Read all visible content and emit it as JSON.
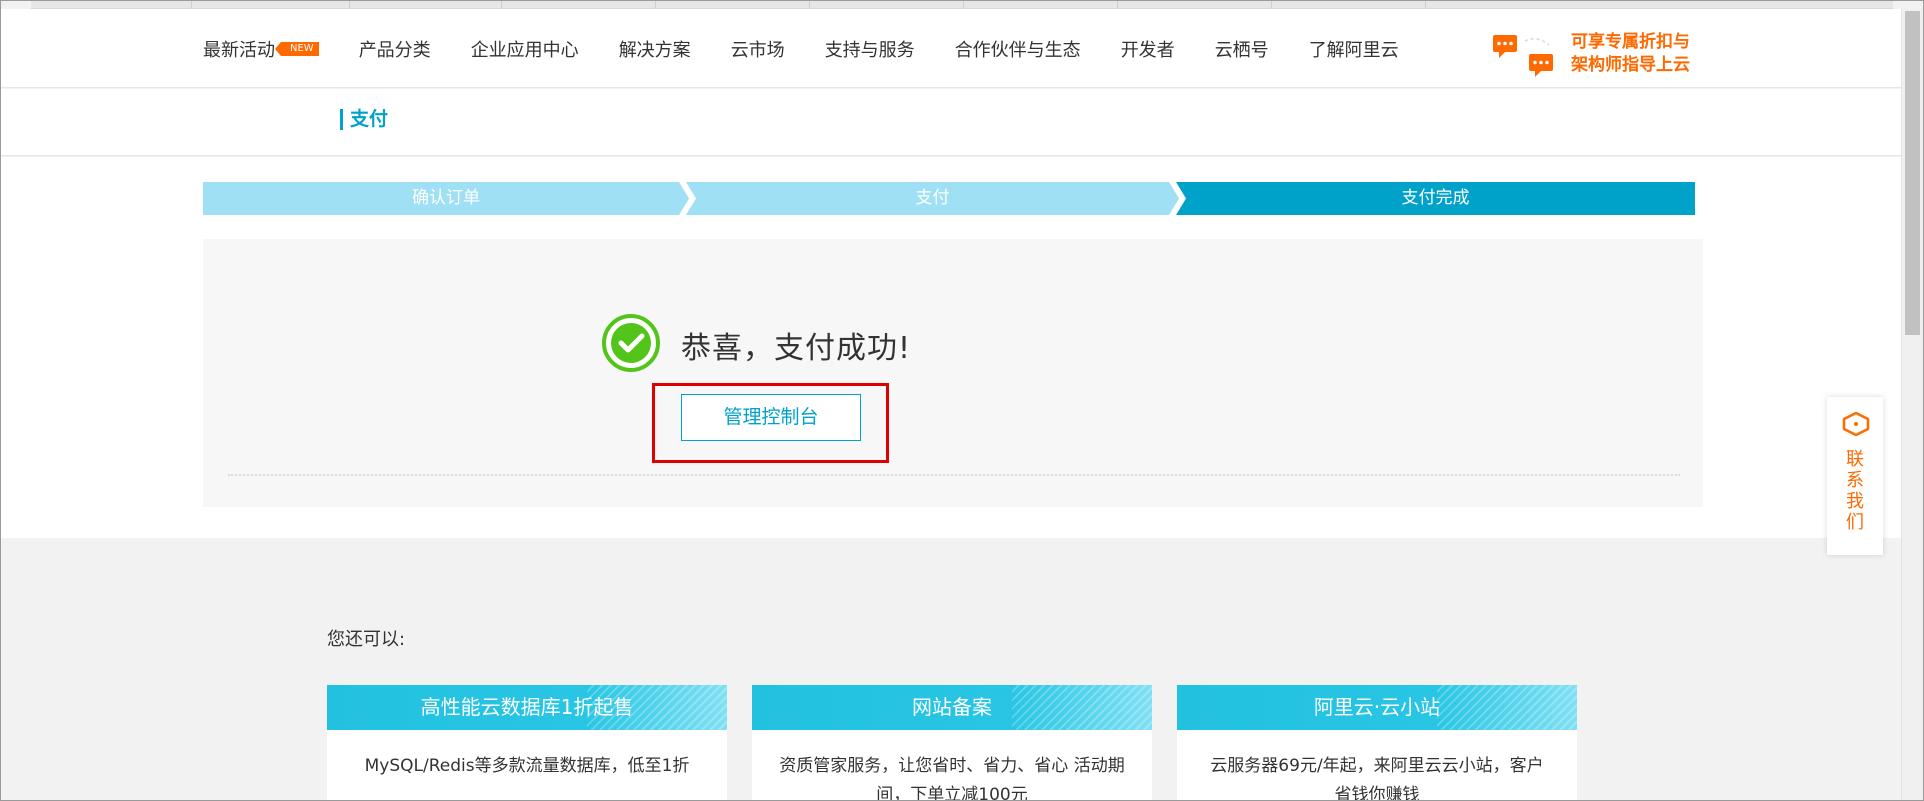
{
  "nav": {
    "items": [
      {
        "label": "最新活动",
        "badge": "NEW"
      },
      {
        "label": "产品分类"
      },
      {
        "label": "企业应用中心"
      },
      {
        "label": "解决方案"
      },
      {
        "label": "云市场"
      },
      {
        "label": "支持与服务"
      },
      {
        "label": "合作伙伴与生态"
      },
      {
        "label": "开发者"
      },
      {
        "label": "云栖号"
      },
      {
        "label": "了解阿里云"
      }
    ],
    "promo_line1": "可享专属折扣与",
    "promo_line2": "架构师指导上云"
  },
  "page": {
    "title": "支付"
  },
  "steps": [
    "确认订单",
    "支付",
    "支付完成"
  ],
  "success": {
    "message": "恭喜，支付成功!",
    "console_button": "管理控制台"
  },
  "recommend": {
    "label": "您还可以:",
    "cards": [
      {
        "title": "高性能云数据库1折起售",
        "desc": "MySQL/Redis等多款流量数据库，低至1折"
      },
      {
        "title": "网站备案",
        "desc": "资质管家服务，让您省时、省力、省心 活动期间，下单立减100元"
      },
      {
        "title": "阿里云·云小站",
        "desc": "云服务器69元/年起，来阿里云云小站，客户省钱你赚钱"
      }
    ]
  },
  "contact": {
    "label": "联系我们"
  },
  "colors": {
    "accent": "#00a2ca",
    "orange": "#ff6a00",
    "step_inactive": "#9fe0f5",
    "success_green": "#52c41a",
    "highlight_red": "#e00000"
  }
}
